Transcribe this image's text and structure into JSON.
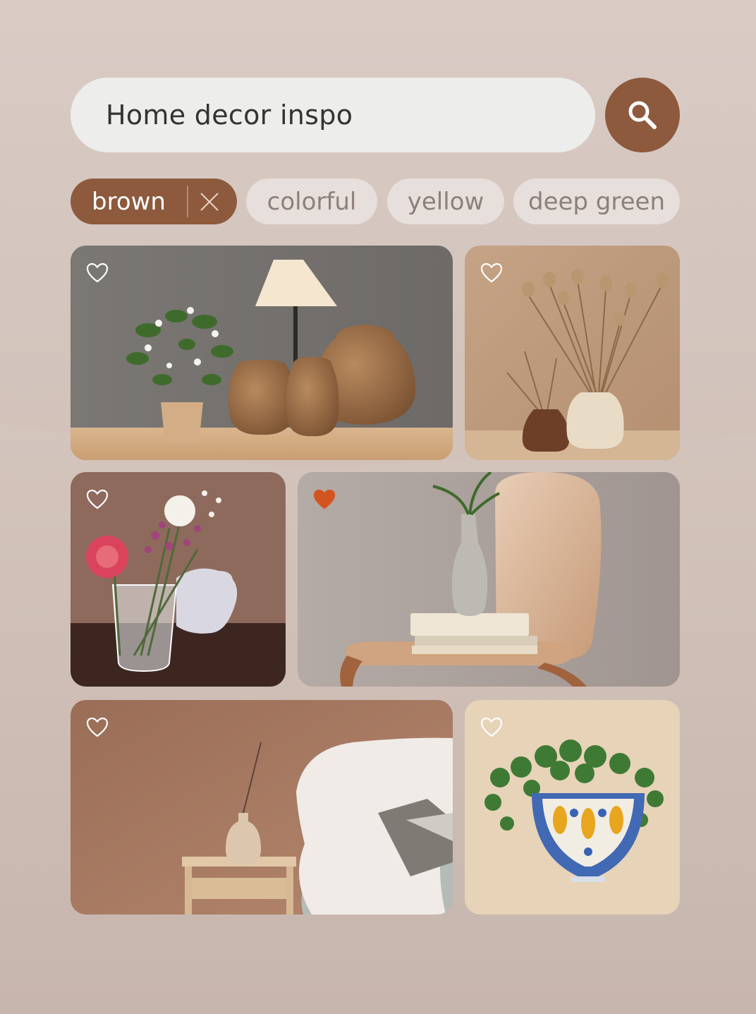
{
  "search": {
    "query": "Home decor inspo"
  },
  "filters": [
    {
      "label": "brown",
      "active": true
    },
    {
      "label": "colorful",
      "active": false
    },
    {
      "label": "yellow",
      "active": false
    },
    {
      "label": "deep green",
      "active": false
    }
  ],
  "results": [
    {
      "subject": "clay vases with lamp and flowering plant",
      "liked": false
    },
    {
      "subject": "dried poppy stems in vases",
      "liked": false
    },
    {
      "subject": "flowers in glass pitcher",
      "liked": false
    },
    {
      "subject": "wooden chair with books and vase",
      "liked": true
    },
    {
      "subject": "side table with vase and fluffy throw",
      "liked": false
    },
    {
      "subject": "hanging ceramic planter",
      "liked": false
    }
  ],
  "colors": {
    "accent": "#8d5a3d",
    "liked_heart": "#d2541e",
    "chip_inactive_bg": "#e6dfdc",
    "search_bg": "#ededeb"
  },
  "icons": {
    "search_button": "search-icon",
    "remove_filter": "close-icon",
    "like": "heart-icon"
  }
}
